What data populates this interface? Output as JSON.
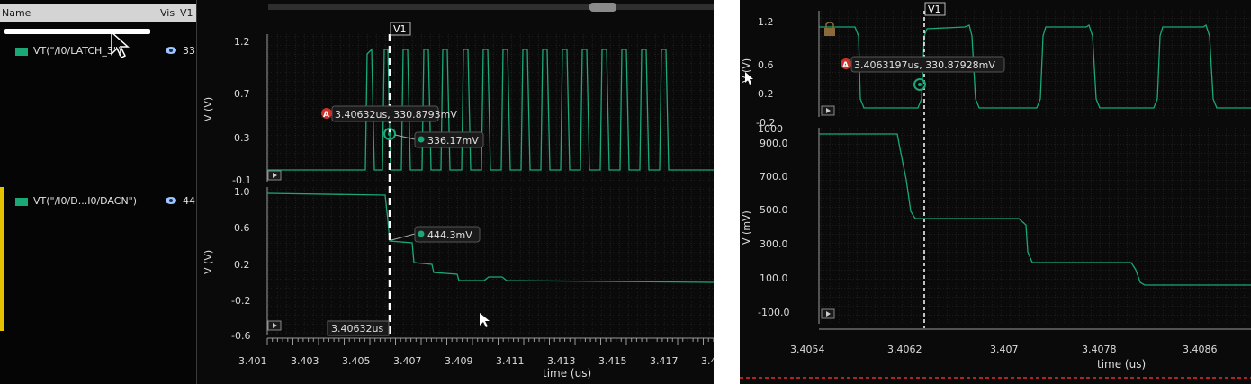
{
  "browser": {
    "header_name": "Name",
    "header_vis": "Vis",
    "header_v1": "V1",
    "signals": [
      {
        "label": "VT(\"/I0/LATCH_3\")",
        "value": "33"
      },
      {
        "label": "VT(\"/I0/D...I0/DACN\")",
        "value": "44"
      }
    ]
  },
  "left_plot": {
    "marker_name": "V1",
    "top_pane": {
      "ylabel": "V (V)",
      "ytick_labels": [
        "1.2",
        "0.7",
        "0.3",
        "-0.1"
      ],
      "annotation_badge": "A",
      "annotation_text": "3.40632us, 330.8793mV",
      "point_label": "336.17mV"
    },
    "bottom_pane": {
      "ylabel": "V (V)",
      "ytick_labels": [
        "1.0",
        "0.6",
        "0.2",
        "-0.2",
        "-0.6"
      ],
      "point_label": "444.3mV",
      "marker_x_label": "3.40632us"
    },
    "xlabel": "time (us)",
    "xtick_labels": [
      "3.401",
      "3.403",
      "3.405",
      "3.407",
      "3.409",
      "3.411",
      "3.413",
      "3.415",
      "3.417",
      "3.4"
    ]
  },
  "right_plot": {
    "marker_name": "V1",
    "top_pane": {
      "ylabel": "V (V)",
      "ytick_labels": [
        "1.2",
        "0.6",
        "0.2",
        "-0.2"
      ],
      "annotation_badge": "A",
      "annotation_text": "3.4063197us, 330.87928mV"
    },
    "bottom_pane": {
      "ylabel": "V (mV)",
      "ytick_labels": [
        "1000",
        "900.0",
        "700.0",
        "500.0",
        "300.0",
        "100.0",
        "-100.0"
      ]
    },
    "xlabel": "time (us)",
    "xtick_labels": [
      "3.4054",
      "3.4062",
      "3.407",
      "3.4078",
      "3.4086"
    ]
  },
  "colors": {
    "trace": "#1aa877",
    "grid": "#3b3b3b",
    "background": "#0a0a0a",
    "marker": "#ffffff",
    "badge": "#d0322b"
  }
}
